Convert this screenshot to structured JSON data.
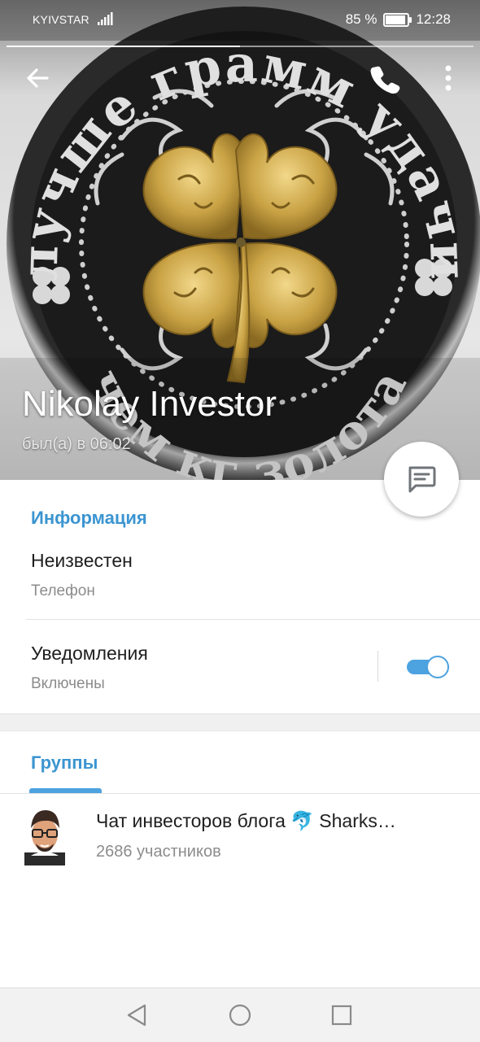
{
  "status_bar": {
    "carrier": "KYIVSTAR",
    "network": "4G",
    "battery_text": "85 %",
    "battery_level": 0.85,
    "time": "12:28"
  },
  "header": {
    "story_progress": 0.5,
    "back_icon": "arrow-left-icon",
    "call_icon": "phone-icon",
    "more_icon": "more-vertical-icon",
    "photo": {
      "coin_text_top": "лучше грамм удачи",
      "coin_text_bottom": "чем кг золота"
    },
    "name": "Nikolay Investor",
    "status": "был(а) в 06:02",
    "fab_icon": "message-icon"
  },
  "info": {
    "title": "Информация",
    "phone_value": "Неизвестен",
    "phone_label": "Телефон",
    "notifications_label": "Уведомления",
    "notifications_value": "Включены",
    "notifications_enabled": true
  },
  "groups": {
    "tab_label": "Группы",
    "items": [
      {
        "name": "Чат инвесторов блога 🐬 Sharks…",
        "members": "2686 участников"
      }
    ]
  },
  "nav": {
    "back_icon": "triangle-back-icon",
    "home_icon": "circle-home-icon",
    "recents_icon": "square-recents-icon"
  },
  "colors": {
    "accent": "#3b95d1",
    "toggle": "#4da2e0",
    "text": "#1f1f1f",
    "secondary": "#8c8c8c"
  }
}
